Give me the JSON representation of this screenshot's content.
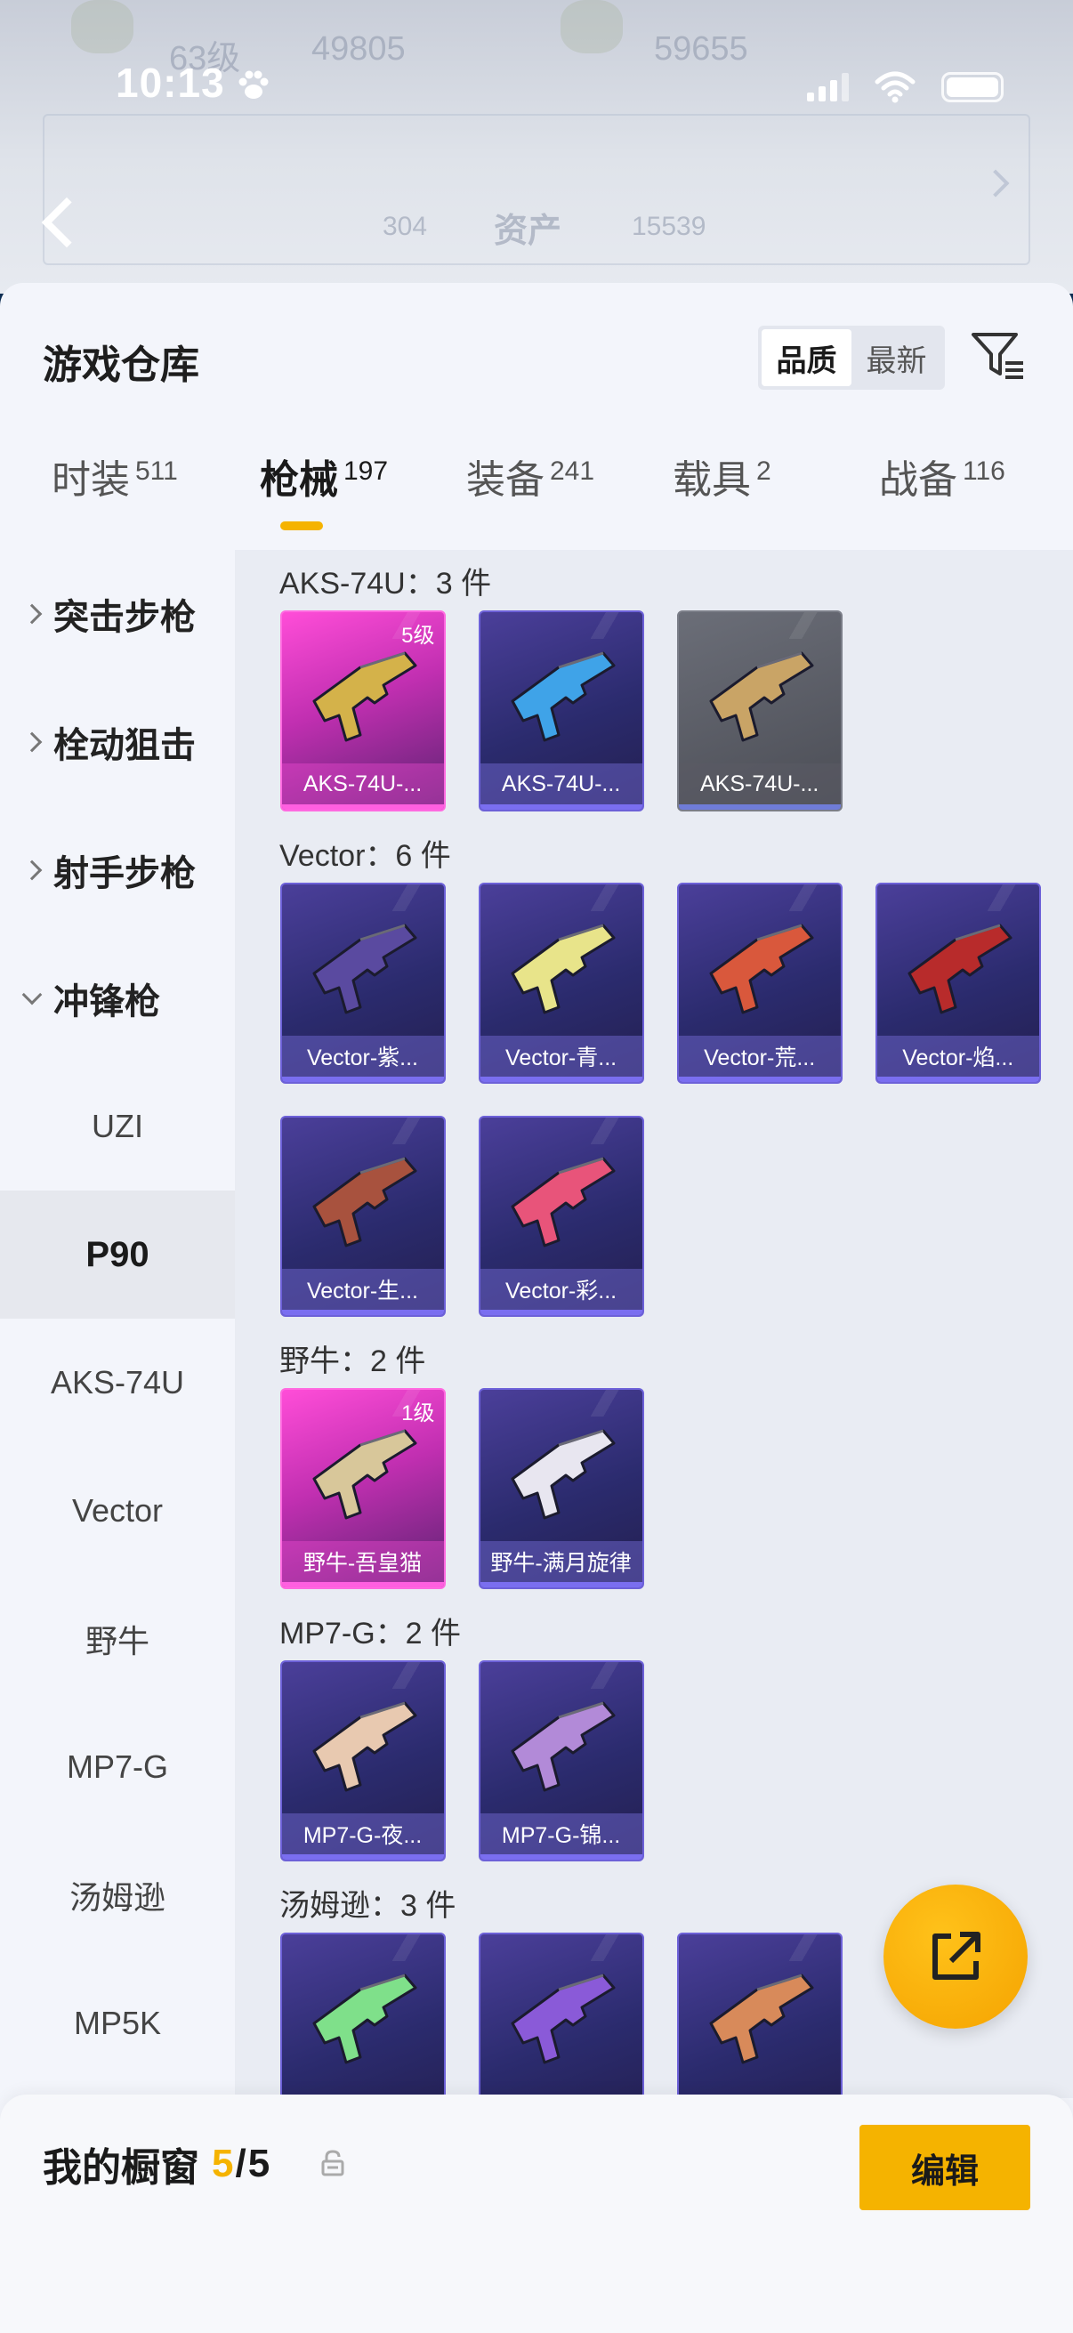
{
  "status_bar": {
    "time": "10:13"
  },
  "background_header": {
    "level": "63级",
    "score1": "49805",
    "score2": "59655",
    "title": "资产",
    "stat_a": "304",
    "stat_b": "15539"
  },
  "sheet": {
    "title": "游戏仓库",
    "sort_options": [
      "品质",
      "最新"
    ],
    "active_sort": "品质"
  },
  "tabs": [
    {
      "label": "时装",
      "count": "511"
    },
    {
      "label": "枪械",
      "count": "197"
    },
    {
      "label": "装备",
      "count": "241"
    },
    {
      "label": "载具",
      "count": "2"
    },
    {
      "label": "战备",
      "count": "116"
    }
  ],
  "sidebar": {
    "categories": [
      {
        "label": "突击步枪"
      },
      {
        "label": "栓动狙击"
      },
      {
        "label": "射手步枪"
      },
      {
        "label": "冲锋枪"
      }
    ],
    "subitems": [
      {
        "label": "UZI"
      },
      {
        "label": "P90"
      },
      {
        "label": "AKS-74U"
      },
      {
        "label": "Vector"
      },
      {
        "label": "野牛"
      },
      {
        "label": "MP7-G"
      },
      {
        "label": "汤姆逊"
      },
      {
        "label": "MP5K"
      }
    ],
    "selected": "P90"
  },
  "sections": [
    {
      "title": "AKS-74U：3 件",
      "items": [
        {
          "name": "AKS-74U-...",
          "rarity": "pink",
          "level": "5级",
          "color": "#d4b24a"
        },
        {
          "name": "AKS-74U-...",
          "rarity": "purple",
          "level": "",
          "color": "#3fa3e8"
        },
        {
          "name": "AKS-74U-...",
          "rarity": "gray",
          "level": "",
          "color": "#c9a466"
        }
      ]
    },
    {
      "title": "Vector：6 件",
      "items": [
        {
          "name": "Vector-紫...",
          "rarity": "purple",
          "level": "",
          "color": "#5a4aa0"
        },
        {
          "name": "Vector-青...",
          "rarity": "purple",
          "level": "",
          "color": "#e8e48a"
        },
        {
          "name": "Vector-荒...",
          "rarity": "purple",
          "level": "",
          "color": "#d9583c"
        },
        {
          "name": "Vector-焰...",
          "rarity": "purple",
          "level": "",
          "color": "#b82b2b"
        },
        {
          "name": "Vector-生...",
          "rarity": "purple",
          "level": "",
          "color": "#a8523e"
        },
        {
          "name": "Vector-彩...",
          "rarity": "purple",
          "level": "",
          "color": "#e8547a"
        }
      ]
    },
    {
      "title": "野牛：2 件",
      "items": [
        {
          "name": "野牛-吾皇猫",
          "rarity": "pink",
          "level": "1级",
          "color": "#d8c79a"
        },
        {
          "name": "野牛-满月旋律",
          "rarity": "purple",
          "level": "",
          "color": "#e8e6f0"
        }
      ]
    },
    {
      "title": "MP7-G：2 件",
      "items": [
        {
          "name": "MP7-G-夜...",
          "rarity": "purple",
          "level": "",
          "color": "#e8c9b0"
        },
        {
          "name": "MP7-G-锦...",
          "rarity": "purple",
          "level": "",
          "color": "#b28ad8"
        }
      ]
    },
    {
      "title": "汤姆逊：3 件",
      "items": [
        {
          "name": "",
          "rarity": "purple",
          "level": "",
          "color": "#7fe08a"
        },
        {
          "name": "",
          "rarity": "purple",
          "level": "",
          "color": "#8a5ad8"
        },
        {
          "name": "",
          "rarity": "purple",
          "level": "",
          "color": "#d88a5a"
        }
      ]
    }
  ],
  "bottom_bar": {
    "label": "我的橱窗",
    "count_current": "5",
    "separator": "/",
    "count_total": "5",
    "edit_label": "编辑"
  },
  "colors": {
    "accent": "#f5b300",
    "rare_purple": "#6d61d8",
    "rare_pink": "#ff4dd8"
  }
}
